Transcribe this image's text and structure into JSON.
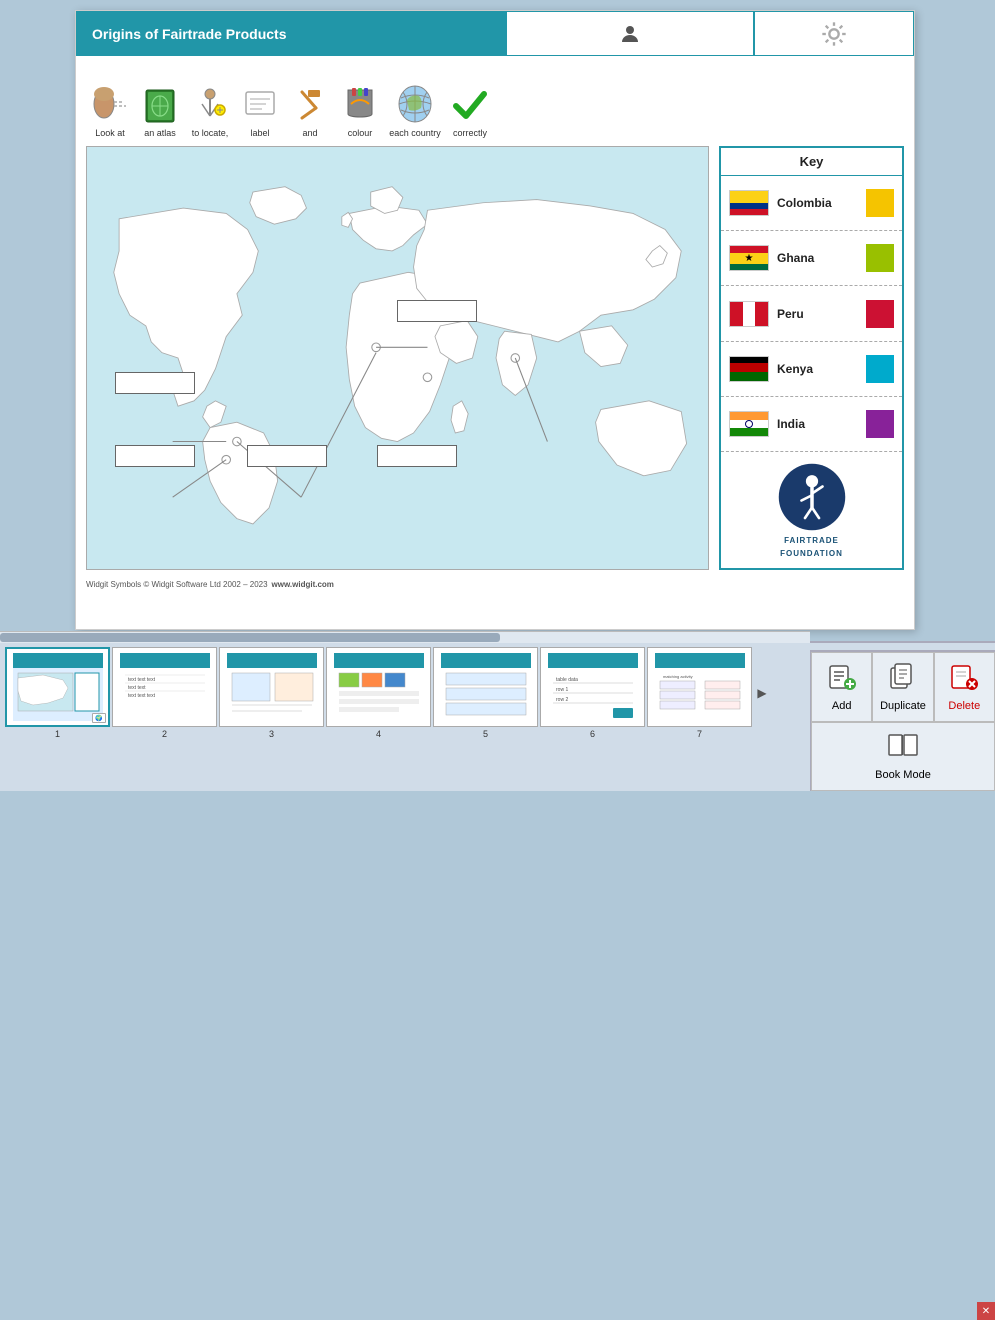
{
  "header": {
    "title": "Origins of Fairtrade Products",
    "user_icon": "user-icon",
    "sun_icon": "sun-icon"
  },
  "instructions": [
    {
      "icon": "👁",
      "label": "Look at"
    },
    {
      "icon": "📗",
      "label": "an atlas"
    },
    {
      "icon": "🧍",
      "label": "to locate,"
    },
    {
      "icon": "🏷",
      "label": "label"
    },
    {
      "icon": "🔨",
      "label": "and"
    },
    {
      "icon": "🌍",
      "label": "colour"
    },
    {
      "icon": "🌐",
      "label": "each country"
    },
    {
      "icon": "✔",
      "label": "correctly"
    }
  ],
  "key": {
    "header": "Key",
    "countries": [
      {
        "name": "Colombia",
        "swatch": "#F5C400"
      },
      {
        "name": "Ghana",
        "swatch": "#99C000"
      },
      {
        "name": "Peru",
        "swatch": "#CC1133"
      },
      {
        "name": "Kenya",
        "swatch": "#00AACC"
      },
      {
        "name": "India",
        "swatch": "#882299"
      }
    ]
  },
  "footer": {
    "copyright": "Widgit Symbols © Widgit Software Ltd 2002 – 2023",
    "url": "www.widgit.com"
  },
  "thumbnails": [
    {
      "num": "1",
      "active": true
    },
    {
      "num": "2",
      "active": false
    },
    {
      "num": "3",
      "active": false
    },
    {
      "num": "4",
      "active": false
    },
    {
      "num": "5",
      "active": false
    },
    {
      "num": "6",
      "active": false
    },
    {
      "num": "7",
      "active": false
    }
  ],
  "toolbar_buttons": {
    "add_label": "Add",
    "duplicate_label": "Duplicate",
    "delete_label": "Delete",
    "book_mode_label": "Book Mode"
  }
}
